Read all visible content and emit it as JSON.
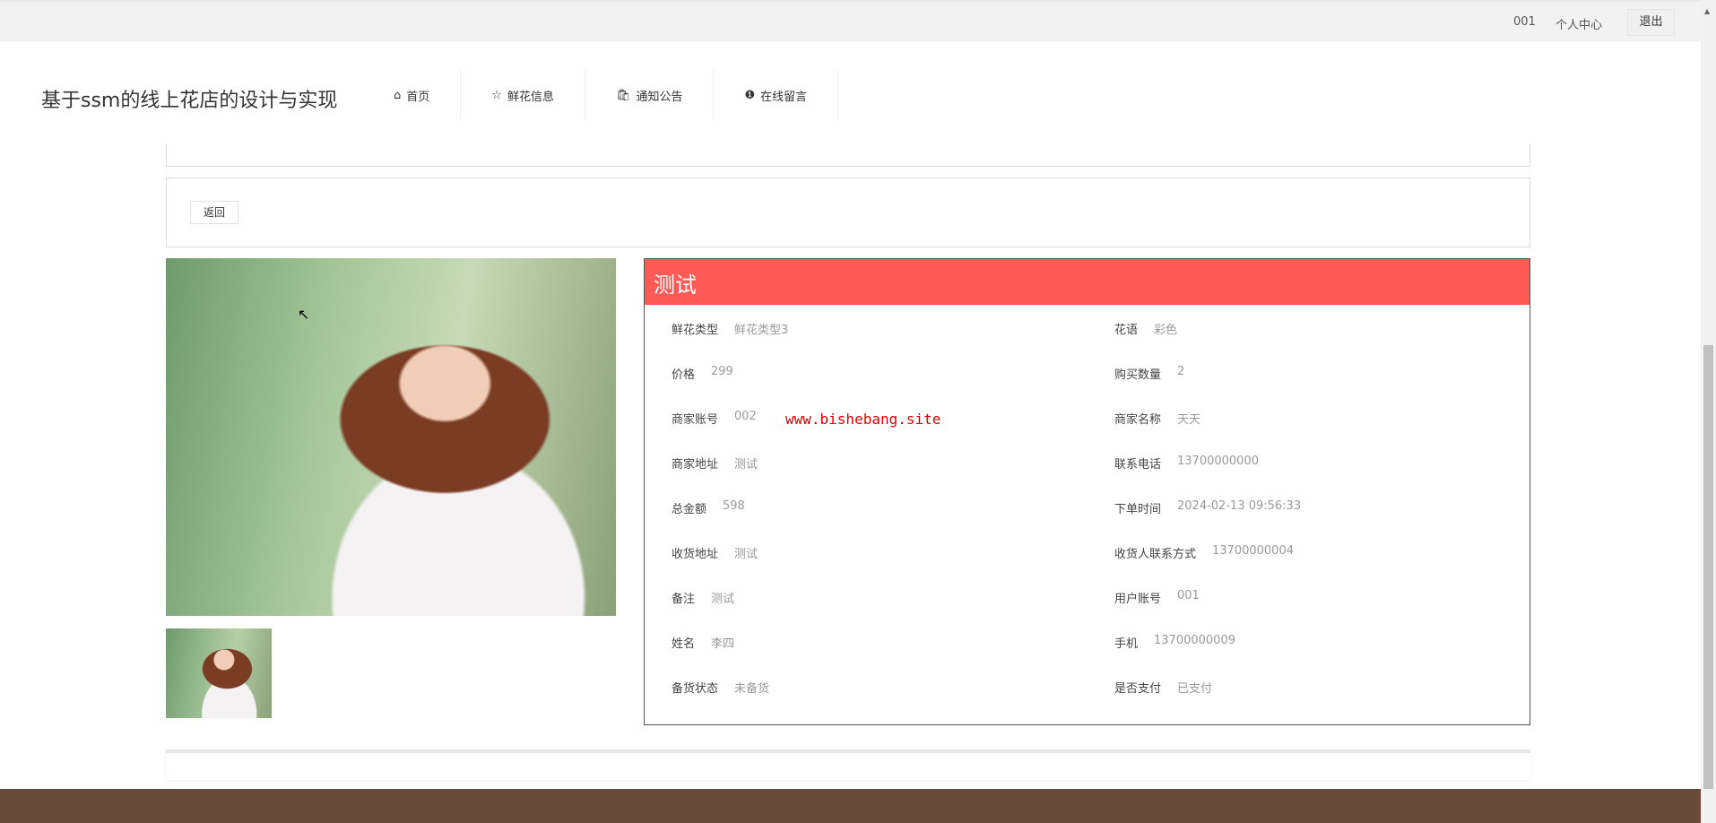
{
  "topbar": {
    "user": "001",
    "center": "个人中心",
    "logout": "退出"
  },
  "site_title": "基于ssm的线上花店的设计与实现",
  "nav": [
    {
      "label": "首页",
      "icon": "home-icon"
    },
    {
      "label": "鲜花信息",
      "icon": "star-icon"
    },
    {
      "label": "通知公告",
      "icon": "bag-icon"
    },
    {
      "label": "在线留言",
      "icon": "alert-icon"
    }
  ],
  "back_label": "返回",
  "detail": {
    "title": "测试",
    "left": [
      {
        "label": "鲜花类型",
        "value": "鲜花类型3"
      },
      {
        "label": "价格",
        "value": "299"
      },
      {
        "label": "商家账号",
        "value": "002"
      },
      {
        "label": "商家地址",
        "value": "测试"
      },
      {
        "label": "总金额",
        "value": "598"
      },
      {
        "label": "收货地址",
        "value": "测试"
      },
      {
        "label": "备注",
        "value": "测试"
      },
      {
        "label": "姓名",
        "value": "李四"
      },
      {
        "label": "备货状态",
        "value": "未备货"
      }
    ],
    "right": [
      {
        "label": "花语",
        "value": "彩色"
      },
      {
        "label": "购买数量",
        "value": "2"
      },
      {
        "label": "商家名称",
        "value": "天天"
      },
      {
        "label": "联系电话",
        "value": "13700000000"
      },
      {
        "label": "下单时间",
        "value": "2024-02-13 09:56:33"
      },
      {
        "label": "收货人联系方式",
        "value": "13700000004"
      },
      {
        "label": "用户账号",
        "value": "001"
      },
      {
        "label": "手机",
        "value": "13700000009"
      },
      {
        "label": "是否支付",
        "value": "已支付"
      }
    ]
  },
  "watermark": "www.bishebang.site",
  "colors": {
    "header": "#ff5a55",
    "footer": "#6a4b3b"
  }
}
